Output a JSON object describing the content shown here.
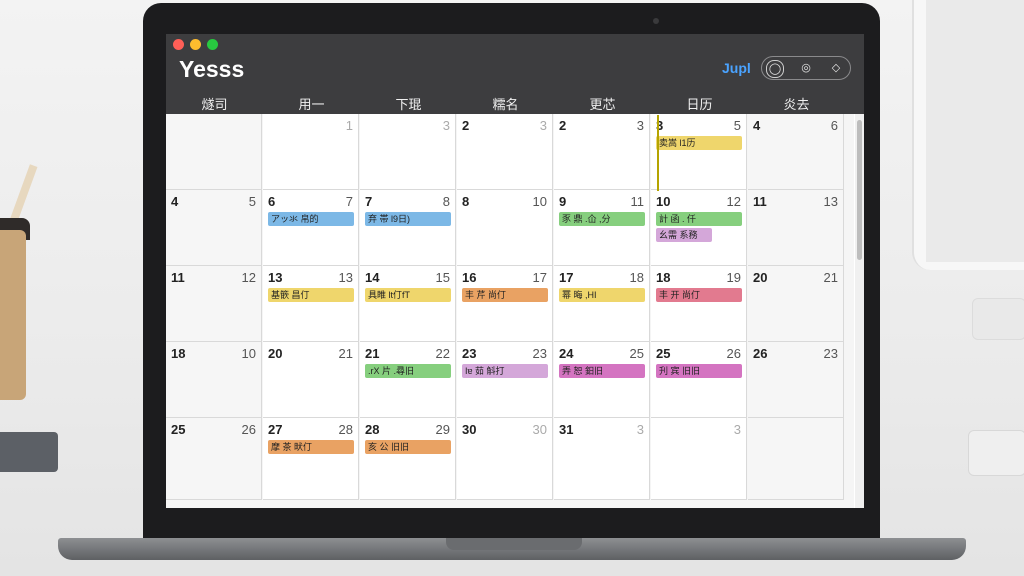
{
  "app": {
    "title": "Yesss",
    "nav_link": "Jupl",
    "window_controls": [
      "close",
      "minimize",
      "zoom"
    ],
    "segments": [
      "◯",
      "◎",
      "◇"
    ]
  },
  "weekdays": [
    "燧司",
    "用一",
    "下琨",
    "糯名",
    "更芯",
    "日历",
    "炎去"
  ],
  "weeks": [
    [
      {
        "left": "",
        "right": "",
        "shade": true
      },
      {
        "left": "",
        "right": "1",
        "gray": true
      },
      {
        "left": "",
        "right": "3",
        "gray": true
      },
      {
        "left": "2",
        "right": "3",
        "gray": true
      },
      {
        "left": "2",
        "right": "3"
      },
      {
        "left": "3",
        "right": "5",
        "today": true,
        "events": [
          {
            "label": "卖嵩 l1历",
            "color": "#efd66c"
          }
        ]
      },
      {
        "left": "4",
        "right": "6",
        "shade": true
      }
    ],
    [
      {
        "left": "4",
        "right": "5",
        "shade": true
      },
      {
        "left": "6",
        "right": "7",
        "events": [
          {
            "label": "アッ氺 帛的",
            "color": "#7cb8e6"
          }
        ]
      },
      {
        "left": "7",
        "right": "8",
        "events": [
          {
            "label": "弃 帯 l9日)",
            "color": "#7cb8e6"
          }
        ]
      },
      {
        "left": "8",
        "right": "10"
      },
      {
        "left": "9",
        "right": "11",
        "events": [
          {
            "label": "豕 鼎 .仚 ,分",
            "color": "#86cf7e"
          }
        ]
      },
      {
        "left": "10",
        "right": "12",
        "events": [
          {
            "label": "計 函 . 仟",
            "color": "#86cf7e"
          },
          {
            "label": "幺需 系務",
            "color": "#d4a7d9"
          }
        ]
      },
      {
        "left": "11",
        "right": "13",
        "shade": true
      }
    ],
    [
      {
        "left": "11",
        "right": "12",
        "shade": true
      },
      {
        "left": "13",
        "right": "13",
        "events": [
          {
            "label": "基篏 昌仃",
            "color": "#efd66c"
          }
        ]
      },
      {
        "left": "14",
        "right": "15",
        "events": [
          {
            "label": "具睢 lt仃fT",
            "color": "#efd66c"
          }
        ]
      },
      {
        "left": "16",
        "right": "17",
        "events": [
          {
            "label": "丰 芹 尚仃",
            "color": "#e9a263"
          }
        ]
      },
      {
        "left": "17",
        "right": "18",
        "events": [
          {
            "label": "幂 晦 ,HI",
            "color": "#efd66c"
          }
        ]
      },
      {
        "left": "18",
        "right": "19",
        "events": [
          {
            "label": "丰 开 尚仃",
            "color": "#e27a8f"
          }
        ]
      },
      {
        "left": "20",
        "right": "21",
        "shade": true
      }
    ],
    [
      {
        "left": "18",
        "right": "10",
        "shade": true
      },
      {
        "left": "20",
        "right": "21"
      },
      {
        "left": "21",
        "right": "22",
        "events": [
          {
            "label": ".rX 片 .尋旧",
            "color": "#86cf7e"
          }
        ]
      },
      {
        "left": "23",
        "right": "23",
        "events": [
          {
            "label": "Iɐ 茹 斛打",
            "color": "#d4a7d9"
          }
        ]
      },
      {
        "left": "24",
        "right": "25",
        "events": [
          {
            "label": "弄 恕 鈤旧",
            "color": "#d474c1"
          }
        ]
      },
      {
        "left": "25",
        "right": "26",
        "events": [
          {
            "label": "刋 宾 旧旧",
            "color": "#d474c1"
          }
        ]
      },
      {
        "left": "26",
        "right": "23",
        "shade": true
      }
    ],
    [
      {
        "left": "25",
        "right": "26",
        "shade": true
      },
      {
        "left": "27",
        "right": "28",
        "events": [
          {
            "label": "摩 茶 畎仃",
            "color": "#e9a263"
          }
        ]
      },
      {
        "left": "28",
        "right": "29",
        "events": [
          {
            "label": "亥 公 旧旧",
            "color": "#e9a263"
          }
        ]
      },
      {
        "left": "30",
        "right": "30",
        "gray": true
      },
      {
        "left": "31",
        "right": "3",
        "gray": true
      },
      {
        "left": "",
        "right": "3",
        "gray": true
      },
      {
        "left": "",
        "right": "",
        "shade": true
      }
    ]
  ]
}
